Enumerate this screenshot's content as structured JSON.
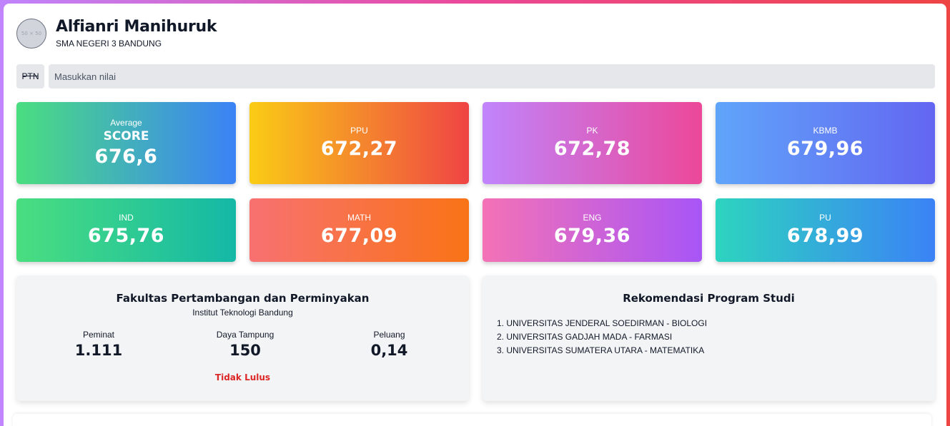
{
  "profile": {
    "avatar_placeholder": "50 × 50",
    "name": "Alfianri Manihuruk",
    "school": "SMA NEGERI 3 BANDUNG"
  },
  "search": {
    "badge": "PTN",
    "placeholder": "Masukkan nilai"
  },
  "scores": {
    "average": {
      "label": "Average",
      "sub": "SCORE",
      "value": "676,6"
    },
    "ppu": {
      "label": "PPU",
      "value": "672,27"
    },
    "pk": {
      "label": "PK",
      "value": "672,78"
    },
    "kbmb": {
      "label": "KBMB",
      "value": "679,96"
    },
    "ind": {
      "label": "IND",
      "value": "675,76"
    },
    "math": {
      "label": "MATH",
      "value": "677,09"
    },
    "eng": {
      "label": "ENG",
      "value": "679,36"
    },
    "pu": {
      "label": "PU",
      "value": "678,99"
    }
  },
  "faculty": {
    "title": "Fakultas Pertambangan dan Perminyakan",
    "institution": "Institut Teknologi Bandung",
    "peminat_label": "Peminat",
    "peminat_value": "1.111",
    "daya_label": "Daya Tampung",
    "daya_value": "150",
    "peluang_label": "Peluang",
    "peluang_value": "0,14",
    "result": "Tidak Lulus",
    "result_color": "#dc2626"
  },
  "recommendation": {
    "title": "Rekomendasi Program Studi",
    "items": [
      "1. UNIVERSITAS JENDERAL SOEDIRMAN - BIOLOGI",
      "2. UNIVERSITAS GADJAH MADA - FARMASI",
      "3. UNIVERSITAS SUMATERA UTARA - MATEMATIKA"
    ]
  }
}
